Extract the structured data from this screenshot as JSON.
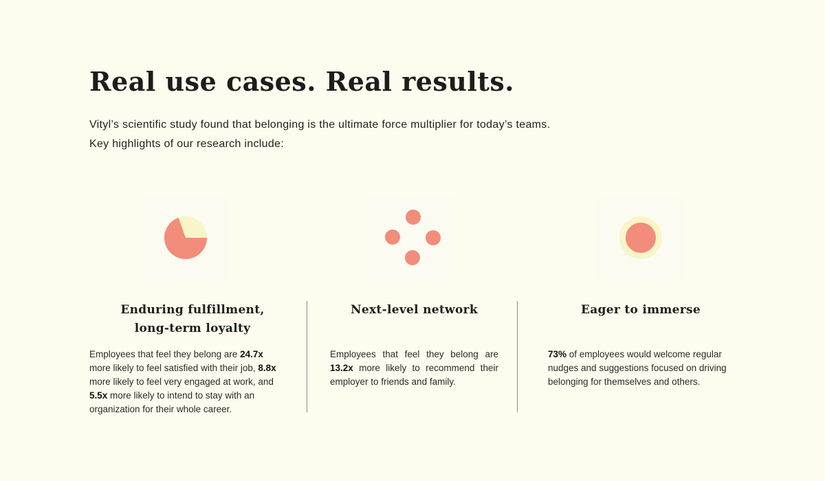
{
  "header": {
    "title": "Real use cases. Real results.",
    "intro_line1": "Vityl’s scientific study found that belonging is the ultimate force multiplier for today’s teams.",
    "intro_line2": "Key highlights of our research include:"
  },
  "colors": {
    "background": "#fdfcee",
    "accent_coral": "#f28c7b",
    "accent_pale_yellow": "#f8f5c9"
  },
  "cards": [
    {
      "icon": "pie-chart-icon",
      "title_line1": "Enduring fulfillment,",
      "title_line2": "long-term loyalty",
      "body": {
        "t1": "Employees that feel they belong are ",
        "b1": "24.7x",
        "t2": " more likely to feel satisfied with their job, ",
        "b2": "8.8x",
        "t3": " more likely to feel very engaged at work, and ",
        "b3": "5.5x",
        "t4": " more likely to intend to stay with an organization for their whole career."
      }
    },
    {
      "icon": "network-dots-icon",
      "title_line1": "Next-level network",
      "body": {
        "t1": "Employees that feel they belong are ",
        "b1": "13.2x",
        "t2": " more likely to recommend their employer to friends and family."
      }
    },
    {
      "icon": "concentric-circle-icon",
      "title_line1": "Eager to immerse",
      "body": {
        "b1": "73%",
        "t1": " of employees would welcome regular nudges and suggestions focused on driving belonging for themselves and others."
      }
    }
  ]
}
